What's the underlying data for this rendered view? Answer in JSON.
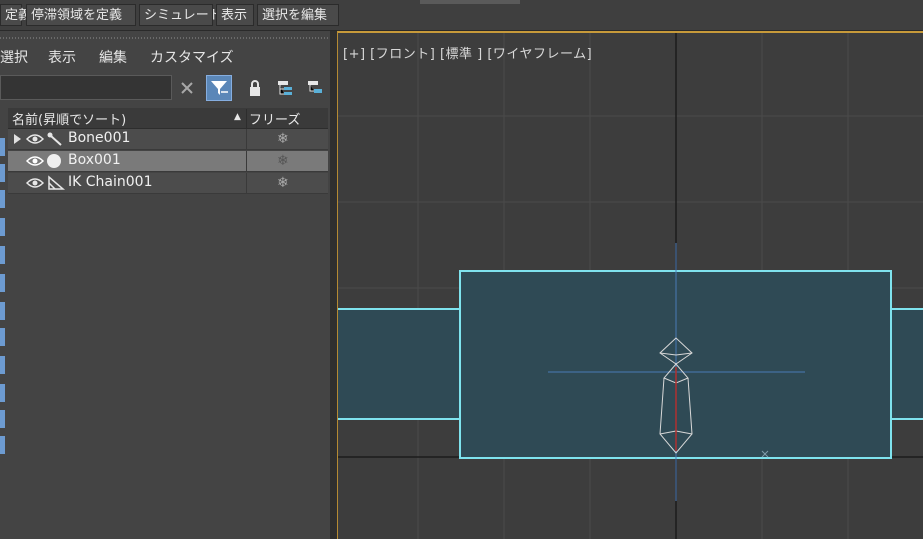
{
  "menubar": {
    "items": [
      "定義",
      "停滞領域を定義",
      "シミュレート",
      "表示",
      "選択を編集"
    ]
  },
  "scene_explorer": {
    "menu": [
      "選択",
      "表示",
      "編集",
      "カスタマイズ"
    ],
    "search": {
      "value": "",
      "placeholder": ""
    },
    "columns": {
      "name": "名前(昇順でソート)",
      "sort_indicator": "▲",
      "freeze": "フリーズ"
    },
    "rows": [
      {
        "name": "Bone001",
        "type_icon": "bone-icon",
        "expandable": true,
        "selected": false
      },
      {
        "name": "Box001",
        "type_icon": "sphere-icon",
        "expandable": false,
        "selected": true
      },
      {
        "name": "IK Chain001",
        "type_icon": "ik-chain-icon",
        "expandable": false,
        "selected": false
      }
    ],
    "freeze_glyph": "❄"
  },
  "viewport": {
    "label": "[+] [フロント] [標準 ] [ワイヤフレーム]",
    "colors": {
      "background": "#3d3d3d",
      "grid": "#4a4a4a",
      "axis": "#1a1a1a",
      "box_fill": "#2f4a55",
      "box_edge": "#7fe3ee",
      "bone": "#d8d8d8",
      "bone_axis": "#4a79b5",
      "ik_line": "#b03030"
    }
  },
  "colors": {
    "accent": "#5b87b8",
    "panel": "#444444",
    "selection": "#7a7a7a",
    "active_border": "#c79a3a"
  }
}
